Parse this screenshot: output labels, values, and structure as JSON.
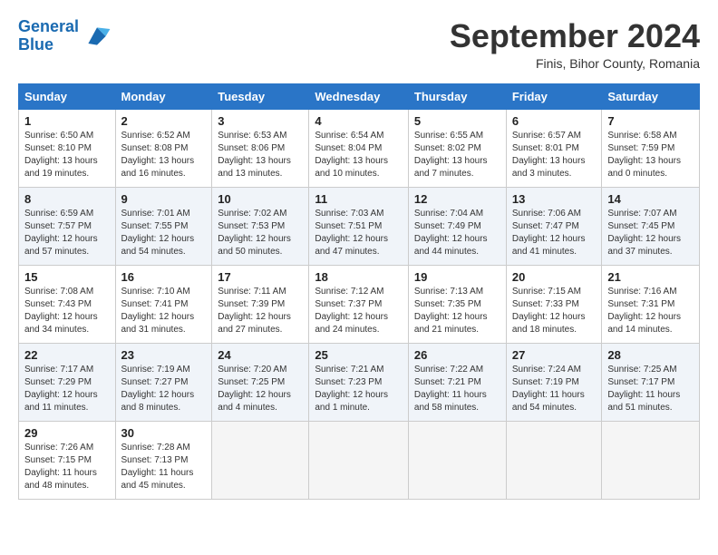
{
  "header": {
    "logo_line1": "General",
    "logo_line2": "Blue",
    "month_title": "September 2024",
    "subtitle": "Finis, Bihor County, Romania"
  },
  "days_of_week": [
    "Sunday",
    "Monday",
    "Tuesday",
    "Wednesday",
    "Thursday",
    "Friday",
    "Saturday"
  ],
  "weeks": [
    [
      {
        "day": "1",
        "info": "Sunrise: 6:50 AM\nSunset: 8:10 PM\nDaylight: 13 hours\nand 19 minutes."
      },
      {
        "day": "2",
        "info": "Sunrise: 6:52 AM\nSunset: 8:08 PM\nDaylight: 13 hours\nand 16 minutes."
      },
      {
        "day": "3",
        "info": "Sunrise: 6:53 AM\nSunset: 8:06 PM\nDaylight: 13 hours\nand 13 minutes."
      },
      {
        "day": "4",
        "info": "Sunrise: 6:54 AM\nSunset: 8:04 PM\nDaylight: 13 hours\nand 10 minutes."
      },
      {
        "day": "5",
        "info": "Sunrise: 6:55 AM\nSunset: 8:02 PM\nDaylight: 13 hours\nand 7 minutes."
      },
      {
        "day": "6",
        "info": "Sunrise: 6:57 AM\nSunset: 8:01 PM\nDaylight: 13 hours\nand 3 minutes."
      },
      {
        "day": "7",
        "info": "Sunrise: 6:58 AM\nSunset: 7:59 PM\nDaylight: 13 hours\nand 0 minutes."
      }
    ],
    [
      {
        "day": "8",
        "info": "Sunrise: 6:59 AM\nSunset: 7:57 PM\nDaylight: 12 hours\nand 57 minutes."
      },
      {
        "day": "9",
        "info": "Sunrise: 7:01 AM\nSunset: 7:55 PM\nDaylight: 12 hours\nand 54 minutes."
      },
      {
        "day": "10",
        "info": "Sunrise: 7:02 AM\nSunset: 7:53 PM\nDaylight: 12 hours\nand 50 minutes."
      },
      {
        "day": "11",
        "info": "Sunrise: 7:03 AM\nSunset: 7:51 PM\nDaylight: 12 hours\nand 47 minutes."
      },
      {
        "day": "12",
        "info": "Sunrise: 7:04 AM\nSunset: 7:49 PM\nDaylight: 12 hours\nand 44 minutes."
      },
      {
        "day": "13",
        "info": "Sunrise: 7:06 AM\nSunset: 7:47 PM\nDaylight: 12 hours\nand 41 minutes."
      },
      {
        "day": "14",
        "info": "Sunrise: 7:07 AM\nSunset: 7:45 PM\nDaylight: 12 hours\nand 37 minutes."
      }
    ],
    [
      {
        "day": "15",
        "info": "Sunrise: 7:08 AM\nSunset: 7:43 PM\nDaylight: 12 hours\nand 34 minutes."
      },
      {
        "day": "16",
        "info": "Sunrise: 7:10 AM\nSunset: 7:41 PM\nDaylight: 12 hours\nand 31 minutes."
      },
      {
        "day": "17",
        "info": "Sunrise: 7:11 AM\nSunset: 7:39 PM\nDaylight: 12 hours\nand 27 minutes."
      },
      {
        "day": "18",
        "info": "Sunrise: 7:12 AM\nSunset: 7:37 PM\nDaylight: 12 hours\nand 24 minutes."
      },
      {
        "day": "19",
        "info": "Sunrise: 7:13 AM\nSunset: 7:35 PM\nDaylight: 12 hours\nand 21 minutes."
      },
      {
        "day": "20",
        "info": "Sunrise: 7:15 AM\nSunset: 7:33 PM\nDaylight: 12 hours\nand 18 minutes."
      },
      {
        "day": "21",
        "info": "Sunrise: 7:16 AM\nSunset: 7:31 PM\nDaylight: 12 hours\nand 14 minutes."
      }
    ],
    [
      {
        "day": "22",
        "info": "Sunrise: 7:17 AM\nSunset: 7:29 PM\nDaylight: 12 hours\nand 11 minutes."
      },
      {
        "day": "23",
        "info": "Sunrise: 7:19 AM\nSunset: 7:27 PM\nDaylight: 12 hours\nand 8 minutes."
      },
      {
        "day": "24",
        "info": "Sunrise: 7:20 AM\nSunset: 7:25 PM\nDaylight: 12 hours\nand 4 minutes."
      },
      {
        "day": "25",
        "info": "Sunrise: 7:21 AM\nSunset: 7:23 PM\nDaylight: 12 hours\nand 1 minute."
      },
      {
        "day": "26",
        "info": "Sunrise: 7:22 AM\nSunset: 7:21 PM\nDaylight: 11 hours\nand 58 minutes."
      },
      {
        "day": "27",
        "info": "Sunrise: 7:24 AM\nSunset: 7:19 PM\nDaylight: 11 hours\nand 54 minutes."
      },
      {
        "day": "28",
        "info": "Sunrise: 7:25 AM\nSunset: 7:17 PM\nDaylight: 11 hours\nand 51 minutes."
      }
    ],
    [
      {
        "day": "29",
        "info": "Sunrise: 7:26 AM\nSunset: 7:15 PM\nDaylight: 11 hours\nand 48 minutes."
      },
      {
        "day": "30",
        "info": "Sunrise: 7:28 AM\nSunset: 7:13 PM\nDaylight: 11 hours\nand 45 minutes."
      },
      {
        "day": "",
        "info": ""
      },
      {
        "day": "",
        "info": ""
      },
      {
        "day": "",
        "info": ""
      },
      {
        "day": "",
        "info": ""
      },
      {
        "day": "",
        "info": ""
      }
    ]
  ]
}
